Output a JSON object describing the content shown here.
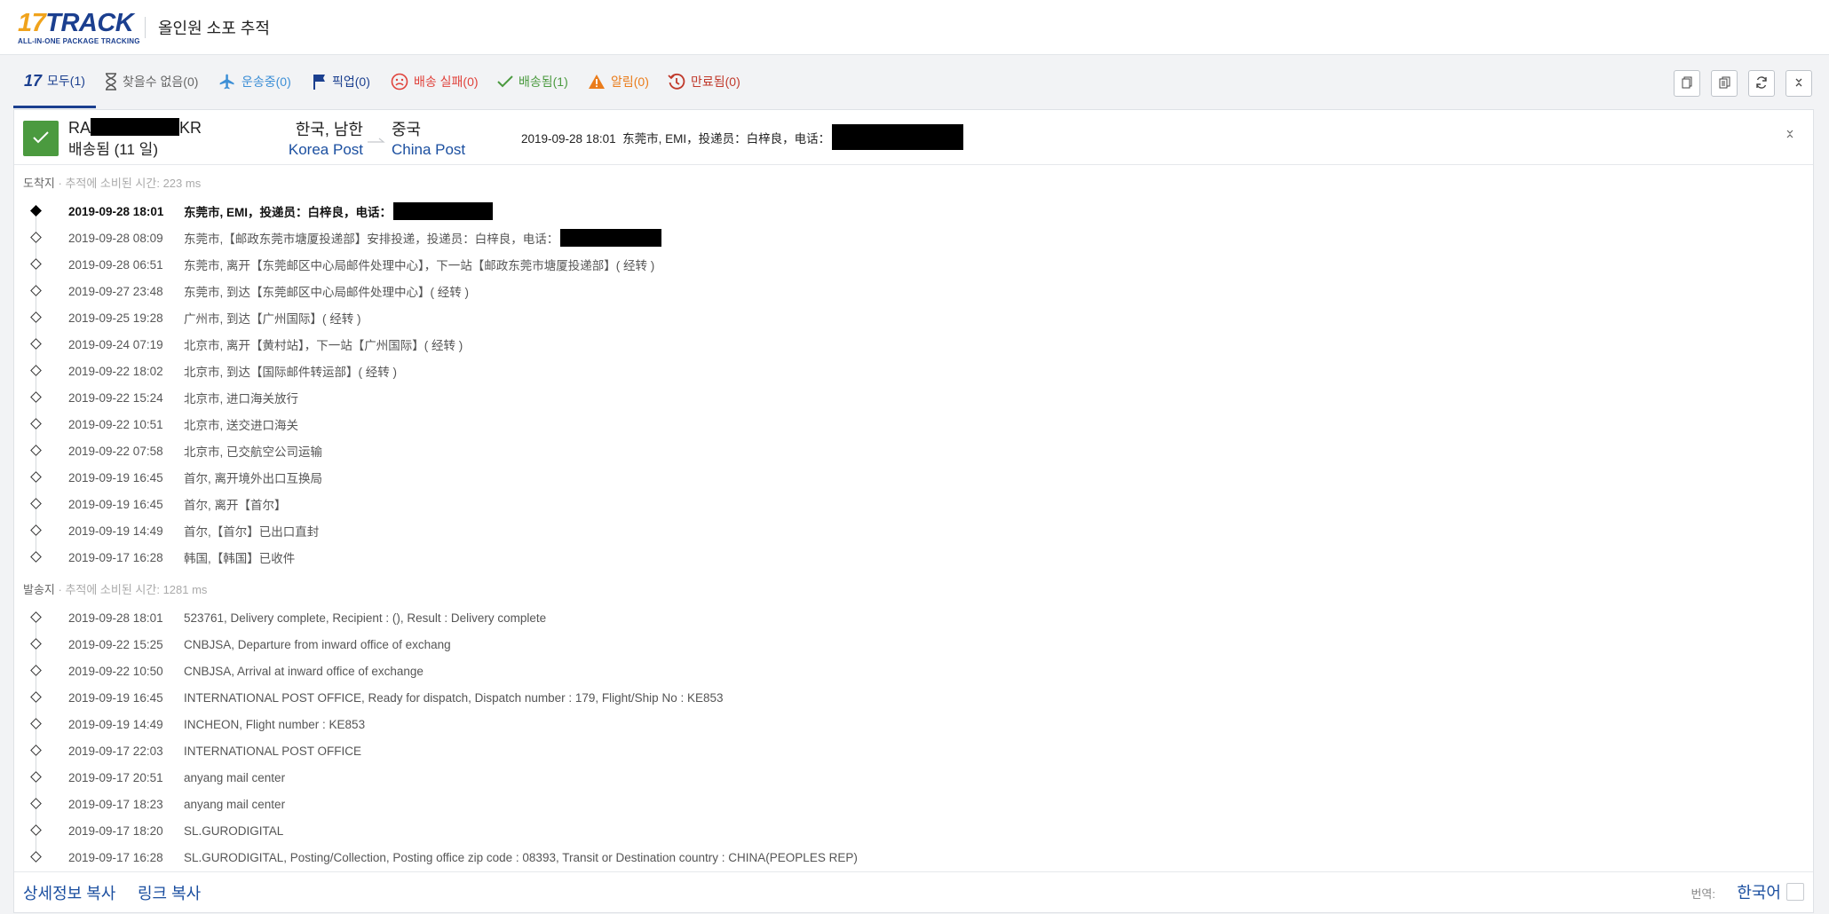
{
  "header": {
    "logo_num": "17",
    "logo_word": "TRACK",
    "logo_tagline": "ALL-IN-ONE PACKAGE TRACKING",
    "title": "올인원 소포 추적"
  },
  "tabs": [
    {
      "label": "모두(1)",
      "icon": "17track-logo-icon"
    },
    {
      "label": "찾을수 없음(0)",
      "icon": "hourglass-icon"
    },
    {
      "label": "운송중(0)",
      "icon": "airplane-icon"
    },
    {
      "label": "픽업(0)",
      "icon": "flag-icon"
    },
    {
      "label": "배송 실패(0)",
      "icon": "sad-face-icon"
    },
    {
      "label": "배송됨(1)",
      "icon": "checkmark-icon"
    },
    {
      "label": "알림(0)",
      "icon": "warning-icon"
    },
    {
      "label": "만료됨(0)",
      "icon": "history-icon"
    }
  ],
  "toolbar": [
    "copy-icon",
    "copy-all-icon",
    "refresh-icon",
    "collapse-all-icon"
  ],
  "shipment": {
    "tracking_prefix": "RA",
    "tracking_suffix": "KR",
    "status": "배송됨 (11 일)",
    "origin_country": "한국, 남한",
    "origin_carrier": "Korea Post",
    "dest_country": "중국",
    "dest_carrier": "China Post",
    "latest_event": "2019-09-28 18:01  东莞市, EMI，投递员：白梓良，电话："
  },
  "destination": {
    "label": "도착지",
    "timing": " · 추적에 소비된 시간: 223 ms",
    "events": [
      {
        "time": "2019-09-28 18:01",
        "desc": "东莞市, EMI，投递员：白梓良，电话：",
        "redact": 112
      },
      {
        "time": "2019-09-28 08:09",
        "desc": "东莞市,【邮政东莞市塘厦投递部】安排投递，投递员：白梓良，电话：",
        "redact": 114
      },
      {
        "time": "2019-09-28 06:51",
        "desc": "东莞市, 离开【东莞邮区中心局邮件处理中心】，下一站【邮政东莞市塘厦投递部】( 经转 )"
      },
      {
        "time": "2019-09-27 23:48",
        "desc": "东莞市, 到达【东莞邮区中心局邮件处理中心】( 经转 )"
      },
      {
        "time": "2019-09-25 19:28",
        "desc": "广州市, 到达【广州国际】( 经转 )"
      },
      {
        "time": "2019-09-24 07:19",
        "desc": "北京市, 离开【黄村站】，下一站【广州国际】( 经转 )"
      },
      {
        "time": "2019-09-22 18:02",
        "desc": "北京市, 到达【国际邮件转运部】( 经转 )"
      },
      {
        "time": "2019-09-22 15:24",
        "desc": "北京市, 进口海关放行"
      },
      {
        "time": "2019-09-22 10:51",
        "desc": "北京市, 送交进口海关"
      },
      {
        "time": "2019-09-22 07:58",
        "desc": "北京市, 已交航空公司运输"
      },
      {
        "time": "2019-09-19 16:45",
        "desc": "首尔, 离开境外出口互换局"
      },
      {
        "time": "2019-09-19 16:45",
        "desc": "首尔, 离开【首尔】"
      },
      {
        "time": "2019-09-19 14:49",
        "desc": "首尔,【首尔】已出口直封"
      },
      {
        "time": "2019-09-17 16:28",
        "desc": "韩国,【韩国】已收件"
      }
    ]
  },
  "origin": {
    "label": "발송지",
    "timing": " · 추적에 소비된 시간: 1281 ms",
    "events": [
      {
        "time": "2019-09-28 18:01",
        "desc": "523761, Delivery complete, Recipient : (), Result : Delivery complete"
      },
      {
        "time": "2019-09-22 15:25",
        "desc": "CNBJSA, Departure from inward office of exchang"
      },
      {
        "time": "2019-09-22 10:50",
        "desc": "CNBJSA, Arrival at inward office of exchange"
      },
      {
        "time": "2019-09-19 16:45",
        "desc": "INTERNATIONAL POST OFFICE, Ready for dispatch, Dispatch number : 179, Flight/Ship No : KE853"
      },
      {
        "time": "2019-09-19 14:49",
        "desc": "INCHEON, Flight number : KE853"
      },
      {
        "time": "2019-09-17 22:03",
        "desc": "INTERNATIONAL POST OFFICE"
      },
      {
        "time": "2019-09-17 20:51",
        "desc": "anyang mail center"
      },
      {
        "time": "2019-09-17 18:23",
        "desc": "anyang mail center"
      },
      {
        "time": "2019-09-17 18:20",
        "desc": "SL.GURODIGITAL"
      },
      {
        "time": "2019-09-17 16:28",
        "desc": "SL.GURODIGITAL, Posting/Collection, Posting office zip code : 08393, Transit or Destination country : CHINA(PEOPLES REP)"
      }
    ]
  },
  "footer": {
    "copy_details": "상세정보 복사",
    "copy_link": "링크 복사",
    "translate_label": "번역:",
    "language": "한국어"
  }
}
